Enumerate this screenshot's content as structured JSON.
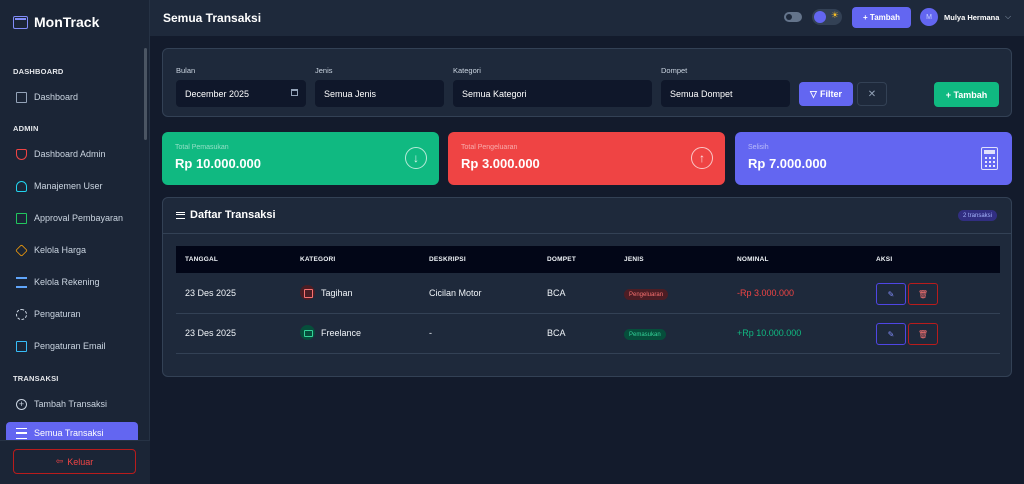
{
  "brand": {
    "name": "MonTrack"
  },
  "sidebar": {
    "sections": [
      {
        "title": "DASHBOARD"
      },
      {
        "title": "ADMIN"
      },
      {
        "title": "TRANSAKSI"
      }
    ],
    "items": [
      {
        "label": "Dashboard",
        "icon": "layout-icon"
      },
      {
        "label": "Dashboard Admin",
        "icon": "shield-icon"
      },
      {
        "label": "Manajemen User",
        "icon": "users-icon"
      },
      {
        "label": "Approval Pembayaran",
        "icon": "credit-card-icon"
      },
      {
        "label": "Kelola Harga",
        "icon": "tag-icon"
      },
      {
        "label": "Kelola Rekening",
        "icon": "bank-icon"
      },
      {
        "label": "Pengaturan",
        "icon": "gear-icon"
      },
      {
        "label": "Pengaturan Email",
        "icon": "mail-icon"
      },
      {
        "label": "Tambah Transaksi",
        "icon": "plus-circle-icon"
      },
      {
        "label": "Semua Transaksi",
        "icon": "list-icon",
        "active": true
      }
    ],
    "logout_label": "Keluar"
  },
  "topbar": {
    "title": "Semua Transaksi",
    "add_label": "+ Tambah",
    "user_initial": "M",
    "user_name": "Mulya Hermana"
  },
  "filters": {
    "month_label": "Bulan",
    "month_value": "December 2025",
    "type_label": "Jenis",
    "type_value": "Semua Jenis",
    "category_label": "Kategori",
    "category_value": "Semua Kategori",
    "wallet_label": "Dompet",
    "wallet_value": "Semua Dompet",
    "filter_button": "Filter",
    "clear_button": "✕",
    "add_button": "+ Tambah"
  },
  "stats": {
    "income_label": "Total Pemasukan",
    "income_value": "Rp 10.000.000",
    "expense_label": "Total Pengeluaran",
    "expense_value": "Rp 3.000.000",
    "diff_label": "Selisih",
    "diff_value": "Rp 7.000.000"
  },
  "table": {
    "title": "Daftar Transaksi",
    "count_badge": "2 transaksi",
    "headers": [
      "TANGGAL",
      "KATEGORI",
      "DESKRIPSI",
      "DOMPET",
      "JENIS",
      "NOMINAL",
      "AKSI"
    ],
    "rows": [
      {
        "date": "23 Des 2025",
        "category": "Tagihan",
        "description": "Cicilan Motor",
        "wallet": "BCA",
        "type": "Pengeluaran",
        "amount": "-Rp 3.000.000"
      },
      {
        "date": "23 Des 2025",
        "category": "Freelance",
        "description": "-",
        "wallet": "BCA",
        "type": "Pemasukan",
        "amount": "+Rp 10.000.000"
      }
    ]
  },
  "colors": {
    "accent": "#6366f1",
    "income": "#10b981",
    "expense": "#ef4444",
    "background": "#131b2c"
  }
}
